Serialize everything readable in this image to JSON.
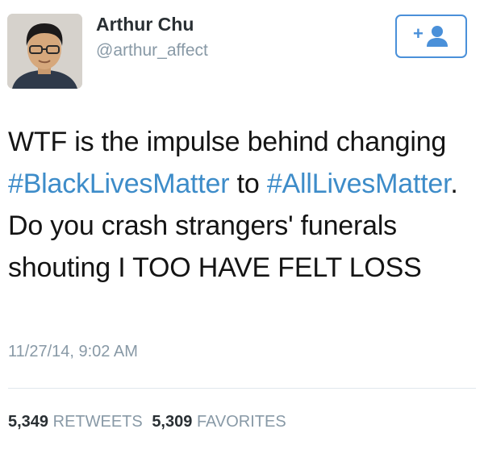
{
  "author": {
    "display_name": "Arthur Chu",
    "handle": "@arthur_affect",
    "avatar_icon": "profile-photo"
  },
  "follow_button": {
    "icon": "add-person-icon",
    "plus_glyph": "+",
    "accent_color": "#4a90d9"
  },
  "tweet": {
    "segments": [
      {
        "text": "WTF is the impulse behind changing ",
        "type": "text"
      },
      {
        "text": "#BlackLivesMatter",
        "type": "hashtag"
      },
      {
        "text": " to ",
        "type": "text"
      },
      {
        "text": "#AllLivesMatter",
        "type": "hashtag"
      },
      {
        "text": ". Do you crash strangers' funerals shouting I TOO HAVE FELT LOSS",
        "type": "text"
      }
    ],
    "hashtag_color": "#3d8cc9",
    "timestamp": "11/27/14, 9:02 AM"
  },
  "stats": {
    "retweets_count": "5,349",
    "retweets_label": "RETWEETS",
    "favorites_count": "5,309",
    "favorites_label": "FAVORITES"
  }
}
